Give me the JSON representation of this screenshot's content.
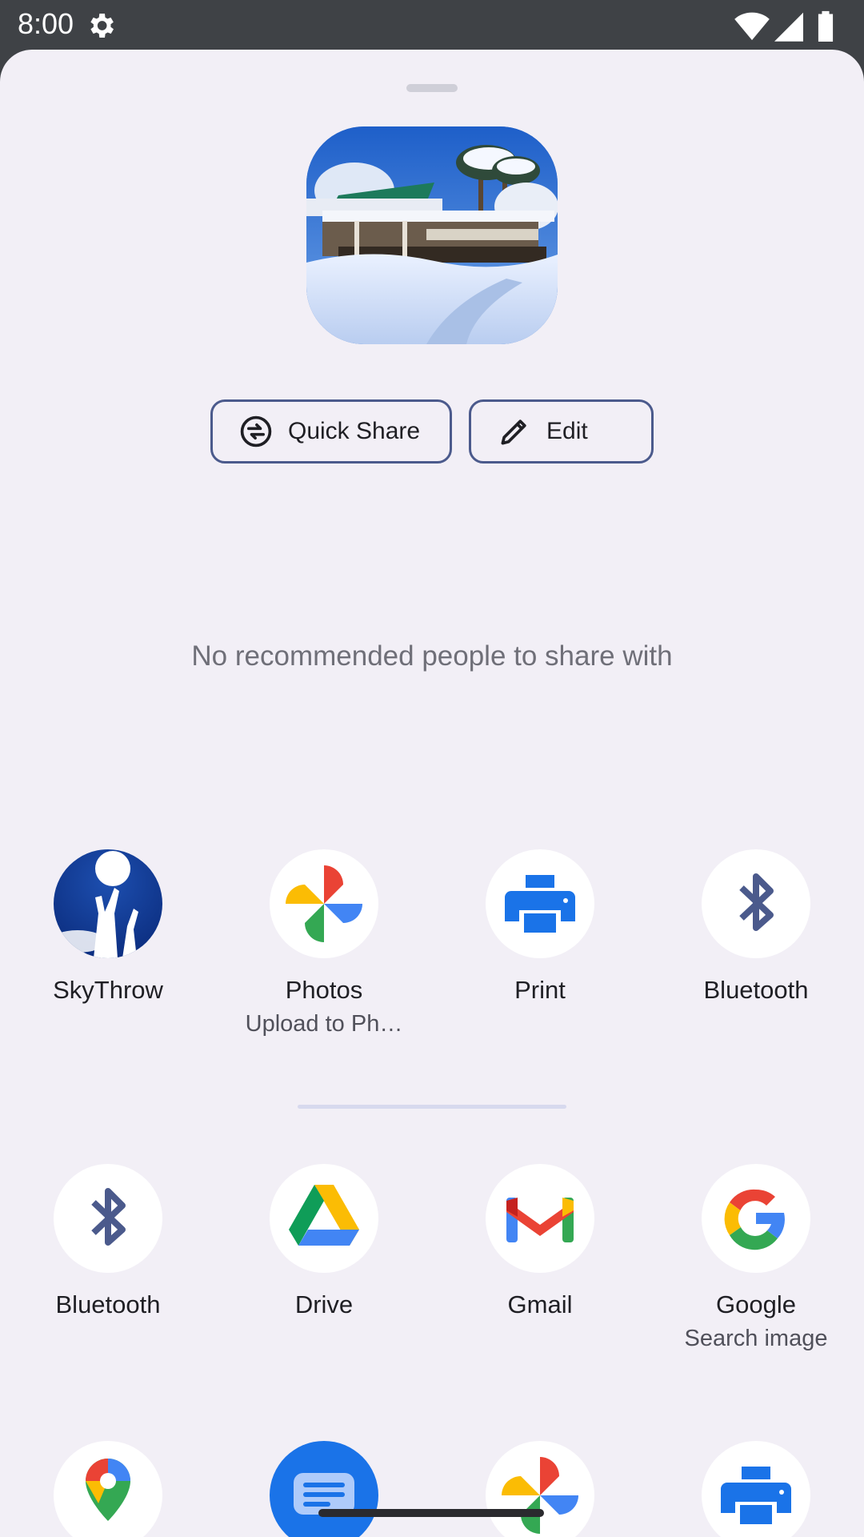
{
  "status_bar": {
    "time": "8:00",
    "icons": [
      "gear-icon",
      "wifi-icon",
      "cell-signal-icon",
      "battery-icon"
    ]
  },
  "share_sheet": {
    "preview": "snowy building photo thumbnail",
    "actions": [
      {
        "label": "Quick Share",
        "icon": "quick-share-icon"
      },
      {
        "label": "Edit",
        "icon": "pencil-icon"
      }
    ],
    "no_people_text": "No recommended people to share with",
    "direct_apps": [
      {
        "label": "SkyThrow",
        "sublabel": "",
        "icon": "skythrow-icon"
      },
      {
        "label": "Photos",
        "sublabel": "Upload to Ph…",
        "icon": "photos-icon"
      },
      {
        "label": "Print",
        "sublabel": "",
        "icon": "printer-icon"
      },
      {
        "label": "Bluetooth",
        "sublabel": "",
        "icon": "bluetooth-icon"
      }
    ],
    "all_apps": [
      {
        "label": "Bluetooth",
        "sublabel": "",
        "icon": "bluetooth-icon"
      },
      {
        "label": "Drive",
        "sublabel": "",
        "icon": "drive-icon"
      },
      {
        "label": "Gmail",
        "sublabel": "",
        "icon": "gmail-icon"
      },
      {
        "label": "Google",
        "sublabel": "Search image",
        "icon": "google-icon"
      }
    ],
    "partial_apps": [
      {
        "icon": "maps-icon"
      },
      {
        "icon": "messages-icon"
      },
      {
        "icon": "photos-icon"
      },
      {
        "icon": "printer-icon"
      }
    ]
  },
  "colors": {
    "sheet_bg": "#f2eff6",
    "chip_border": "#4b5a8c",
    "status_bar_bg": "#3f4246"
  }
}
